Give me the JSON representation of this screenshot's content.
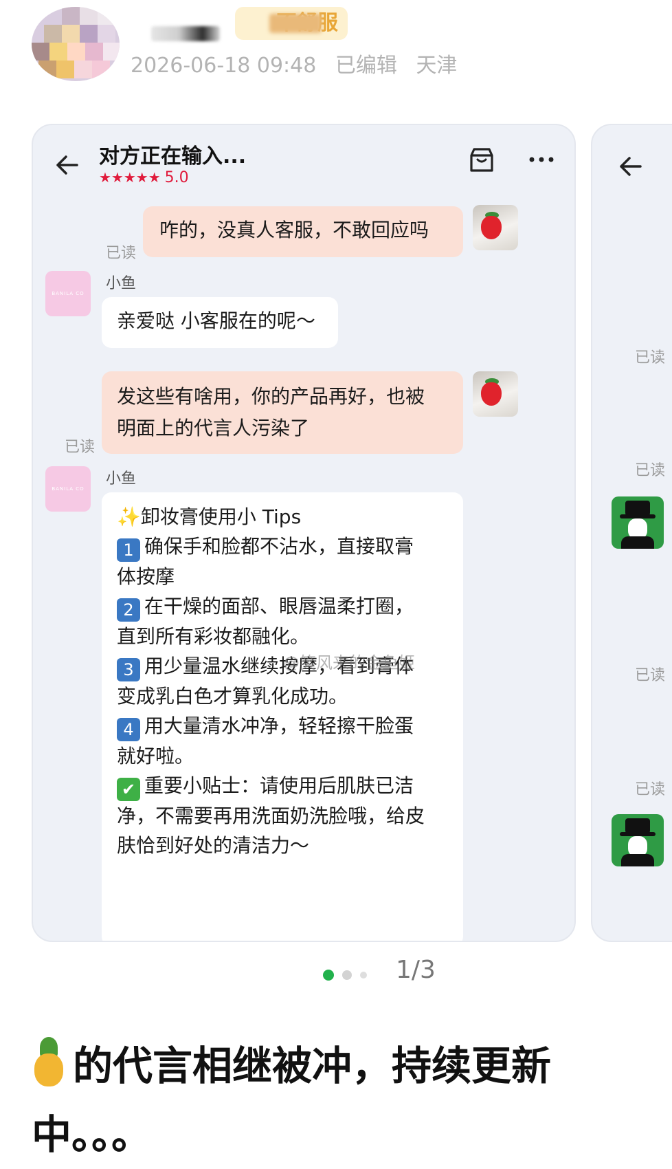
{
  "post": {
    "badge_text": "不舒服",
    "date": "2026-06-18 09:48",
    "edited": "已编辑",
    "location": "天津"
  },
  "chat": {
    "title": "对方正在输入...",
    "stars": "★★★★★",
    "rating": "5.0",
    "read_label": "已读",
    "agent_name": "小鱼",
    "brand_logo_text": "BANILA CO",
    "messages": [
      {
        "from": "me",
        "text": "咋的，没真人客服，不敢回应吗"
      },
      {
        "from": "agent",
        "text": "亲爱哒 小客服在的呢～"
      },
      {
        "from": "me",
        "text_lines": [
          "发这些有啥用，你的产品再好，也被",
          "明面上的代言人污染了"
        ]
      }
    ],
    "tips": {
      "title": "卸妆膏使用小 Tips",
      "items": [
        {
          "num": "1",
          "lines": [
            "确保手和脸都不沾水，直接取膏",
            "体按摩"
          ]
        },
        {
          "num": "2",
          "lines": [
            "在干燥的面部、眼唇温柔打圈，",
            "直到所有彩妆都融化。"
          ]
        },
        {
          "num": "3",
          "lines": [
            "用少量温水继续按摩，看到膏体",
            "变成乳白色才算乳化成功。"
          ]
        },
        {
          "num": "4",
          "lines": [
            "用大量清水冲净，轻轻擦干脸蛋",
            "就好啦。"
          ]
        }
      ],
      "tip": {
        "lines": [
          "重要小贴士：请使用后肌肤已洁",
          "净，不需要再用洗面奶洗脸哦，给皮",
          "肤恰到好处的清洁力～"
        ]
      }
    },
    "watermark": "@笑风来的金鱼姬"
  },
  "peek": {
    "read_labels": [
      "已读",
      "已读",
      "已读",
      "已读"
    ]
  },
  "pager": {
    "text": "1/3",
    "active_color": "#22b14c"
  },
  "caption": {
    "text": "的代言相继被冲，持续更新中。。。"
  }
}
